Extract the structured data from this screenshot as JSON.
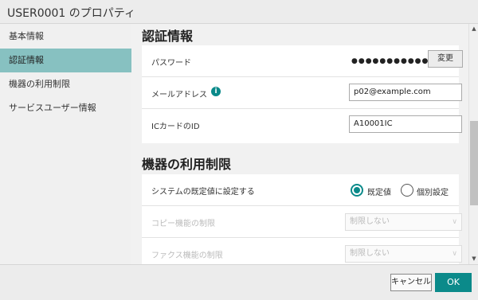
{
  "window": {
    "title": "USER0001 のプロパティ"
  },
  "sidebar": {
    "items": [
      {
        "label": "基本情報"
      },
      {
        "label": "認証情報"
      },
      {
        "label": "機器の利用制限"
      },
      {
        "label": "サービスユーザー情報"
      }
    ]
  },
  "auth": {
    "heading": "認証情報",
    "password_label": "パスワード",
    "password_mask": "●●●●●●●●●●●●",
    "change_button": "変更",
    "email_label": "メールアドレス",
    "email_value": "p02@example.com",
    "iccard_label": "ICカードのID",
    "iccard_value": "A10001IC"
  },
  "restrictions": {
    "heading": "機器の利用制限",
    "system_default_label": "システムの既定値に設定する",
    "option_default": "既定値",
    "option_individual": "個別設定",
    "copy_label": "コピー機能の制限",
    "copy_value": "制限しない",
    "fax_label": "ファクス機能の制限",
    "fax_value": "制限しない"
  },
  "footer": {
    "cancel": "キャンセル",
    "ok": "OK"
  },
  "colors": {
    "accent": "#0b8a8a",
    "sidebar_active": "#87c1c1"
  },
  "icons": {
    "info": "info-icon",
    "scroll_up": "scroll-up-icon",
    "scroll_down": "scroll-down-icon",
    "dropdown": "chevron-down-icon"
  }
}
